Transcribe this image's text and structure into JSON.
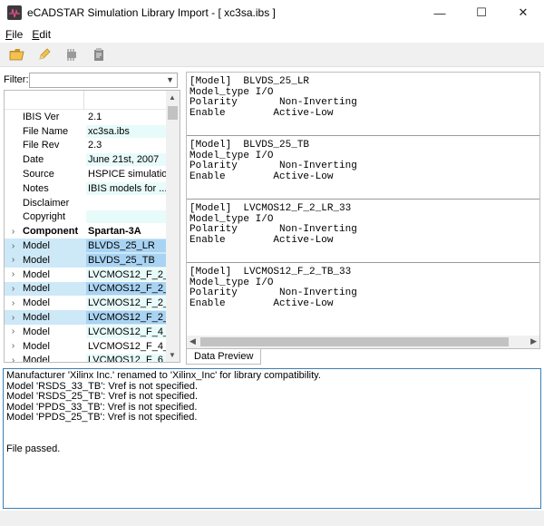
{
  "window": {
    "title": "eCADSTAR Simulation Library Import - [ xc3sa.ibs ]",
    "controls": {
      "minimize": "—",
      "maximize": "☐",
      "close": "✕"
    }
  },
  "menu": [
    {
      "label": "File",
      "mnemonic": "F",
      "rest": "ile"
    },
    {
      "label": "Edit",
      "mnemonic": "E",
      "rest": "dit"
    }
  ],
  "toolbar": {
    "icons": [
      "open-folder-icon",
      "pencil-icon",
      "component-icon",
      "clipboard-icon"
    ]
  },
  "filter": {
    "label": "Filter:",
    "value": ""
  },
  "tree": {
    "rows": [
      {
        "expander": "",
        "key": "IBIS Ver",
        "value": "2.1",
        "selected": false,
        "bold": false
      },
      {
        "expander": "",
        "key": "File Name",
        "value": "xc3sa.ibs",
        "selected": false,
        "bold": false
      },
      {
        "expander": "",
        "key": "File Rev",
        "value": "2.3",
        "selected": false,
        "bold": false
      },
      {
        "expander": "",
        "key": "Date",
        "value": "June 21st, 2007",
        "selected": false,
        "bold": false
      },
      {
        "expander": "",
        "key": "Source",
        "value": "HSPICE simulatio...",
        "selected": false,
        "bold": false
      },
      {
        "expander": "",
        "key": "Notes",
        "value": "IBIS models for ...",
        "selected": false,
        "bold": false
      },
      {
        "expander": "",
        "key": "Disclaimer",
        "value": "",
        "selected": false,
        "bold": false
      },
      {
        "expander": "",
        "key": "Copyright",
        "value": "",
        "selected": false,
        "bold": false
      },
      {
        "expander": "›",
        "key": "Component",
        "value": "Spartan-3A",
        "selected": false,
        "bold": true
      },
      {
        "expander": "›",
        "key": "Model",
        "value": "BLVDS_25_LR",
        "selected": true,
        "bold": false
      },
      {
        "expander": "›",
        "key": "Model",
        "value": "BLVDS_25_TB",
        "selected": true,
        "bold": false
      },
      {
        "expander": "›",
        "key": "Model",
        "value": "LVCMOS12_F_2_...",
        "selected": false,
        "bold": false
      },
      {
        "expander": "›",
        "key": "Model",
        "value": "LVCMOS12_F_2_...",
        "selected": true,
        "bold": false
      },
      {
        "expander": "›",
        "key": "Model",
        "value": "LVCMOS12_F_2_...",
        "selected": false,
        "bold": false
      },
      {
        "expander": "›",
        "key": "Model",
        "value": "LVCMOS12_F_2_...",
        "selected": true,
        "bold": false
      },
      {
        "expander": "›",
        "key": "Model",
        "value": "LVCMOS12_F_4_...",
        "selected": false,
        "bold": false
      },
      {
        "expander": "›",
        "key": "Model",
        "value": "LVCMOS12_F_4_...",
        "selected": false,
        "bold": false
      },
      {
        "expander": "›",
        "key": "Model",
        "value": "LVCMOS12_F_6_...",
        "selected": false,
        "bold": false
      }
    ]
  },
  "preview": {
    "blocks": [
      "[Model]  BLVDS_25_LR\nModel_type I/O\nPolarity       Non-Inverting\nEnable        Active-Low",
      "[Model]  BLVDS_25_TB\nModel_type I/O\nPolarity       Non-Inverting\nEnable        Active-Low",
      "[Model]  LVCMOS12_F_2_LR_33\nModel_type I/O\nPolarity       Non-Inverting\nEnable        Active-Low",
      "[Model]  LVCMOS12_F_2_TB_33\nModel_type I/O\nPolarity       Non-Inverting\nEnable        Active-Low"
    ],
    "tab_label": "Data Preview"
  },
  "log": {
    "lines_top": [
      "Manufacturer 'Xilinx Inc.' renamed to 'Xilinx_Inc' for library compatibility.",
      "Model 'RSDS_33_TB': Vref is not specified.",
      "Model 'RSDS_25_TB': Vref is not specified.",
      "Model 'PPDS_33_TB': Vref is not specified.",
      "Model 'PPDS_25_TB': Vref is not specified."
    ],
    "result": "File passed."
  }
}
